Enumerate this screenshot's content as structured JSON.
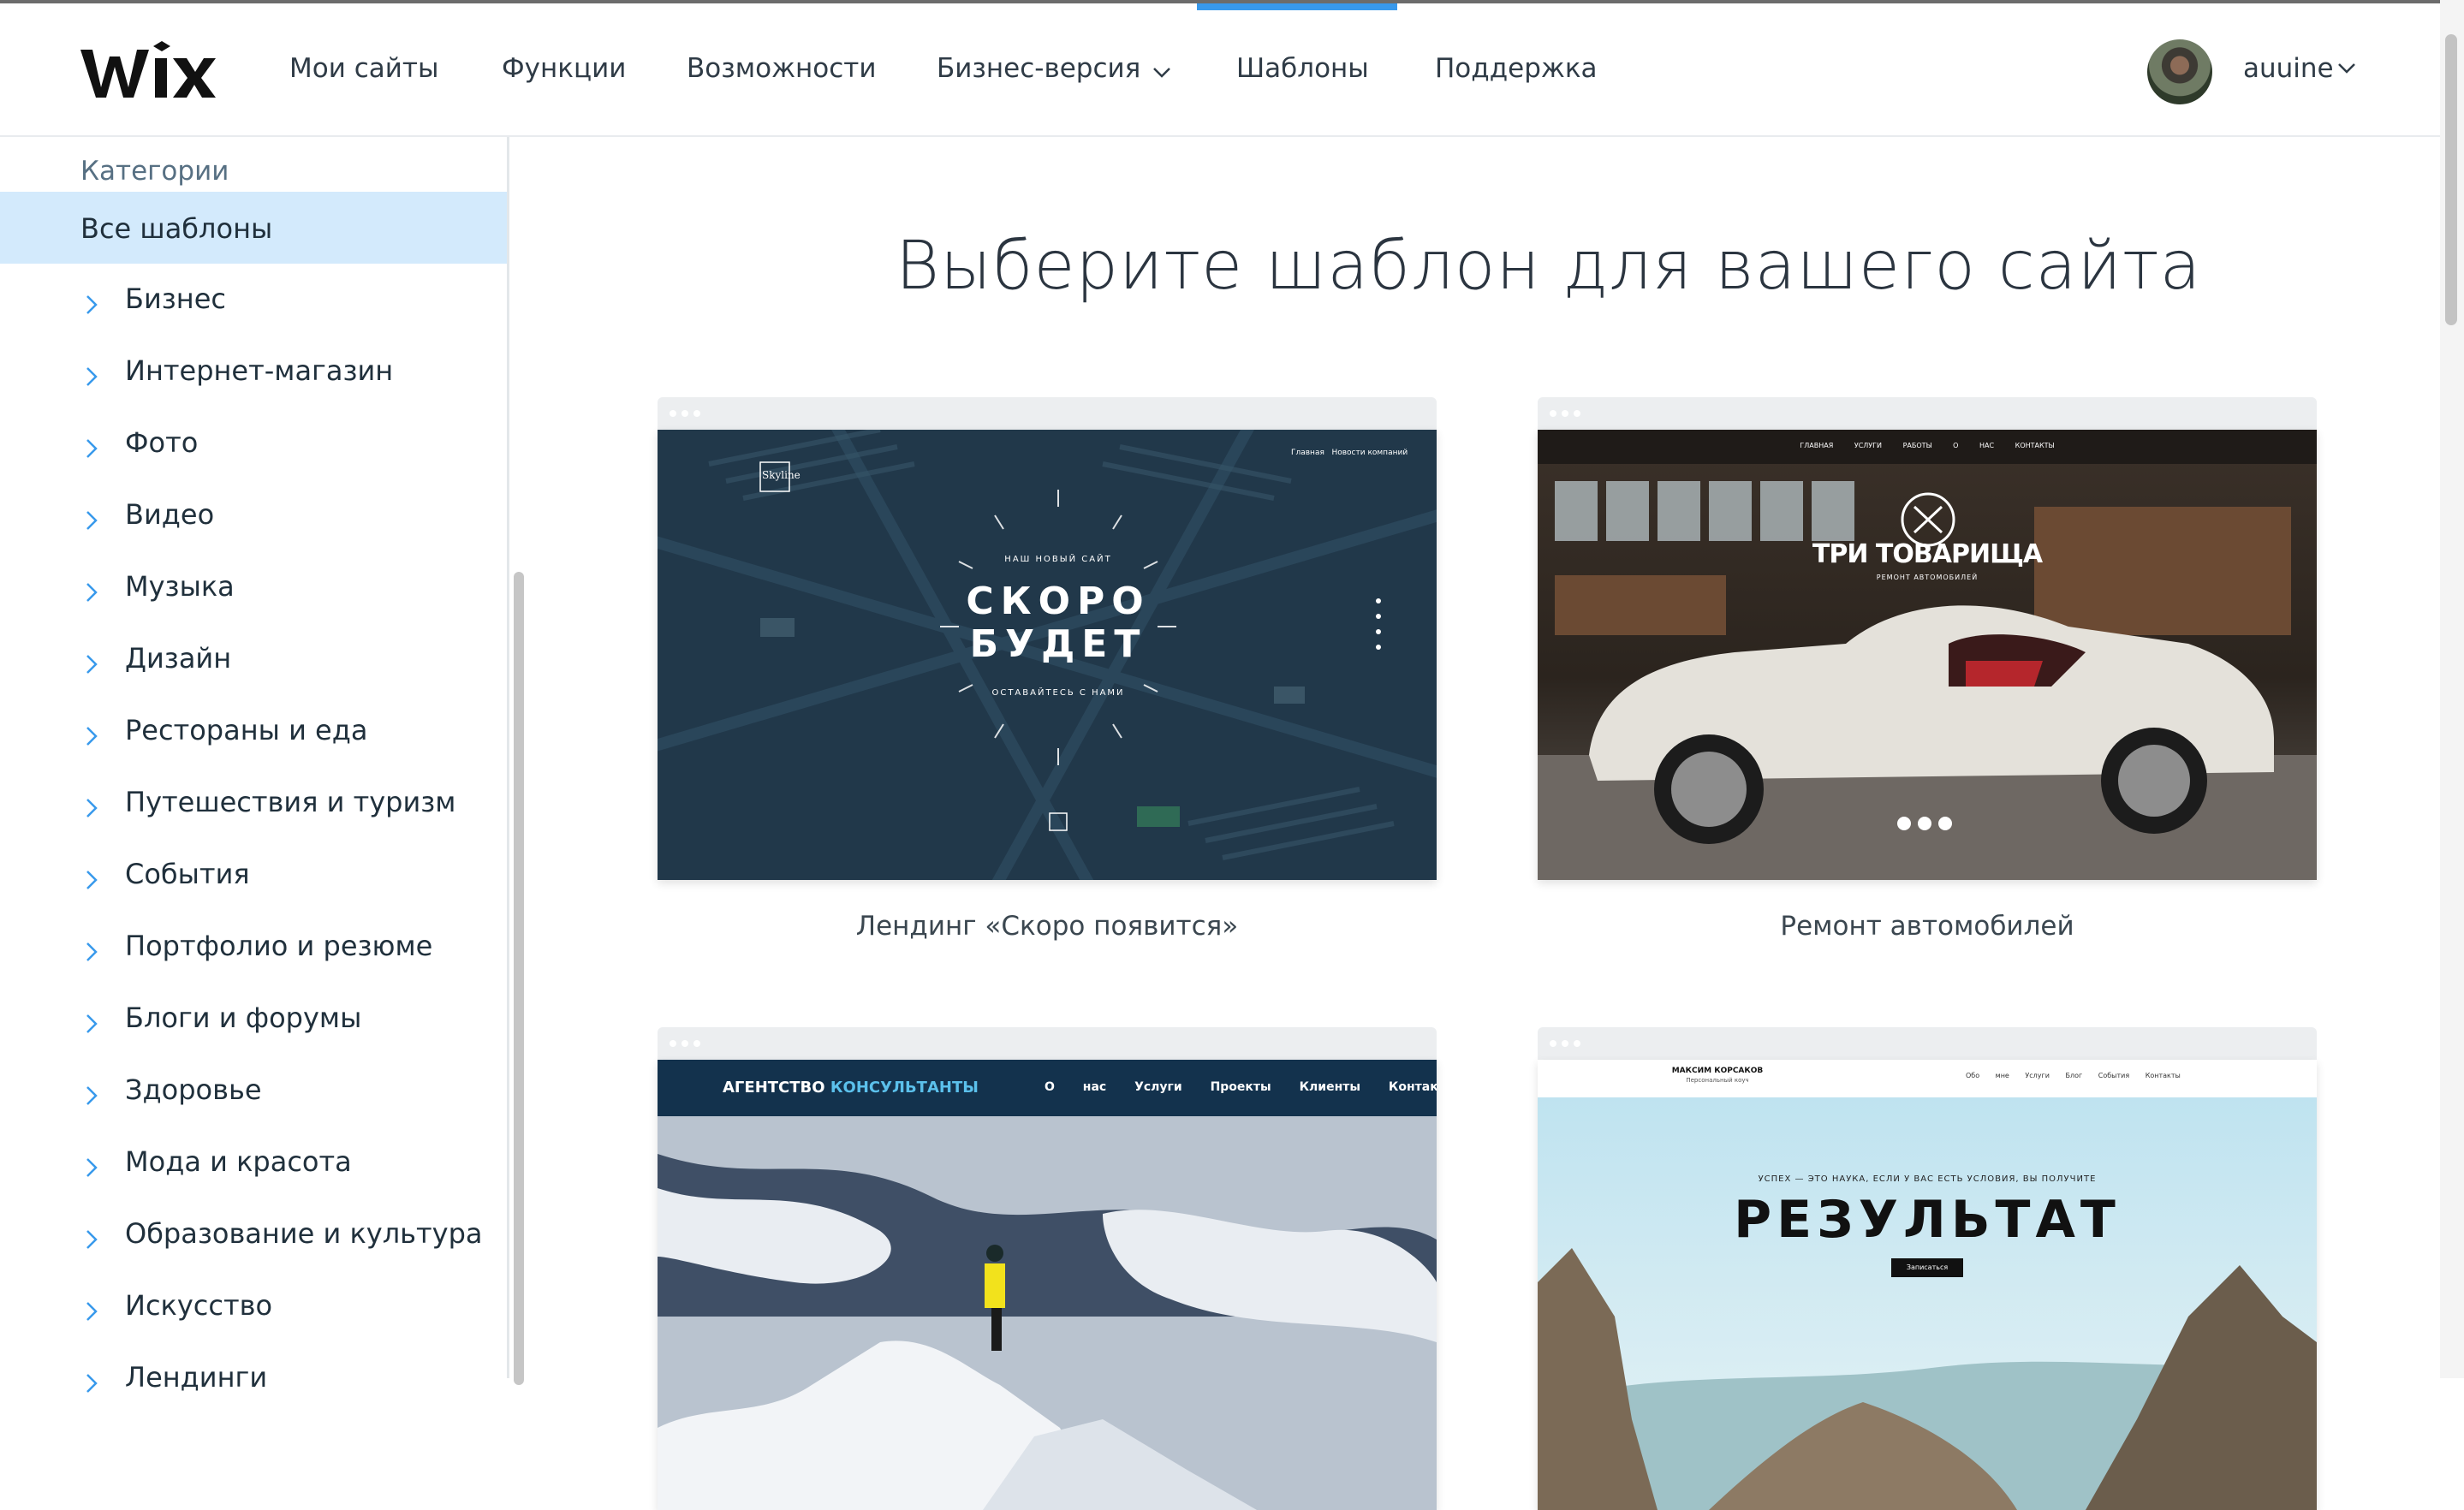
{
  "header": {
    "logo": "WiX",
    "nav": [
      {
        "label": "Мои сайты"
      },
      {
        "label": "Функции"
      },
      {
        "label": "Возможности"
      },
      {
        "label": "Бизнес-версия"
      },
      {
        "label": "Шаблоны",
        "active": true
      },
      {
        "label": "Поддержка"
      }
    ],
    "user": {
      "name": "auuine"
    }
  },
  "sidebar": {
    "heading": "Категории",
    "active": "Все шаблоны",
    "items": [
      "Бизнес",
      "Интернет-магазин",
      "Фото",
      "Видео",
      "Музыка",
      "Дизайн",
      "Рестораны и еда",
      "Путешествия и туризм",
      "События",
      "Портфолио и резюме",
      "Блоги и форумы",
      "Здоровье",
      "Мода и красота",
      "Образование и культура",
      "Искусство",
      "Лендинги"
    ]
  },
  "main": {
    "title": "Выберите шаблон для вашего сайта",
    "templates": [
      {
        "caption": "Лендинг «Скоро появится»",
        "logo": "Skyline",
        "nav": [
          "Главная",
          "Новости компаний"
        ],
        "kicker": "НАШ НОВЫЙ САЙТ",
        "headline_1": "СКОРО",
        "headline_2": "БУДЕТ",
        "sub": "ОСТАВАЙТЕСЬ С НАМИ"
      },
      {
        "caption": "Ремонт автомобилей",
        "nav": [
          "ГЛАВНАЯ",
          "УСЛУГИ",
          "РАБОТЫ",
          "О НАС",
          "КОНТАКТЫ"
        ],
        "headline": "ТРИ ТОВАРИЩА",
        "sub": "РЕМОНТ АВТОМОБИЛЕЙ"
      },
      {
        "brand_1": "АГЕНТСТВО",
        "brand_2": "КОНСУЛЬТАНТЫ",
        "nav": [
          "О нас",
          "Услуги",
          "Проекты",
          "Клиенты",
          "Контакты"
        ]
      },
      {
        "name": "МАКСИМ КОРСАКОВ",
        "role": "Персональный коуч",
        "nav": [
          "Обо мне",
          "Услуги",
          "Блог",
          "События",
          "Контакты"
        ],
        "kicker": "УСПЕХ — ЭТО НАУКА, ЕСЛИ У ВАС ЕСТЬ УСЛОВИЯ, ВЫ ПОЛУЧИТЕ",
        "headline": "РЕЗУЛЬТАТ",
        "button": "Записаться"
      }
    ]
  },
  "colors": {
    "accent": "#3899ec",
    "active_bg": "#d3eafc",
    "nav_text": "#2f3b46"
  }
}
